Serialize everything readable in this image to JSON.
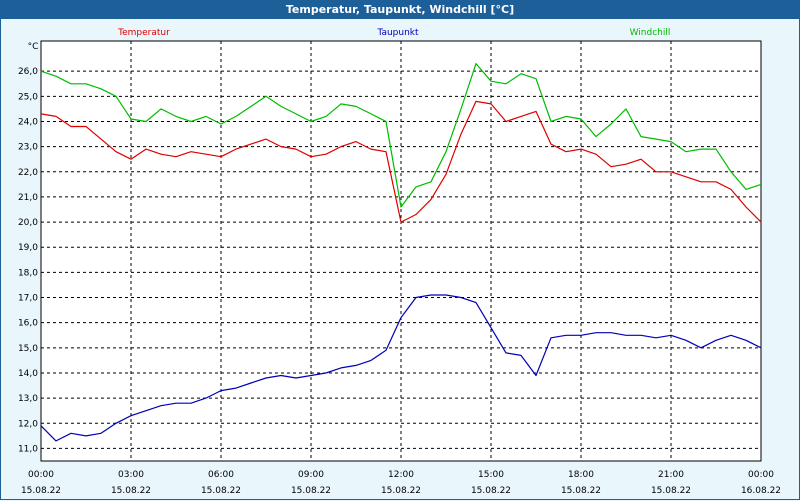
{
  "window": {
    "title": "Temperatur, Taupunkt, Windchill [°C]"
  },
  "colors": {
    "titlebar": "#1c5f99",
    "background": "#e9f6fb"
  },
  "chart_data": {
    "type": "line",
    "title": "Temperatur, Taupunkt, Windchill [°C]",
    "ylabel": "°C",
    "xlabel": "",
    "ylim": [
      10.5,
      27.2
    ],
    "xlim": [
      0,
      24
    ],
    "grid": true,
    "legend_position": "top",
    "y_ticks": [
      "11,0",
      "12,0",
      "13,0",
      "14,0",
      "15,0",
      "16,0",
      "17,0",
      "18,0",
      "19,0",
      "20,0",
      "21,0",
      "22,0",
      "23,0",
      "24,0",
      "25,0",
      "26,0"
    ],
    "x_ticks": [
      {
        "time": "00:00",
        "date": "15.08.22"
      },
      {
        "time": "03:00",
        "date": "15.08.22"
      },
      {
        "time": "06:00",
        "date": "15.08.22"
      },
      {
        "time": "09:00",
        "date": "15.08.22"
      },
      {
        "time": "12:00",
        "date": "15.08.22"
      },
      {
        "time": "15:00",
        "date": "15.08.22"
      },
      {
        "time": "18:00",
        "date": "15.08.22"
      },
      {
        "time": "21:00",
        "date": "15.08.22"
      },
      {
        "time": "00:00",
        "date": "16.08.22"
      }
    ],
    "x_hours": [
      0,
      0.5,
      1,
      1.5,
      2,
      2.5,
      3,
      3.5,
      4,
      4.5,
      5,
      5.5,
      6,
      6.5,
      7,
      7.5,
      8,
      8.5,
      9,
      9.5,
      10,
      10.5,
      11,
      11.5,
      12,
      12.5,
      13,
      13.5,
      14,
      14.5,
      15,
      15.5,
      16,
      16.5,
      17,
      17.5,
      18,
      18.5,
      19,
      19.5,
      20,
      20.5,
      21,
      21.5,
      22,
      22.5,
      23,
      23.5,
      24
    ],
    "series": [
      {
        "name": "Temperatur",
        "color": "#dd0000",
        "values": [
          24.3,
          24.2,
          23.8,
          23.8,
          23.3,
          22.8,
          22.5,
          22.9,
          22.7,
          22.6,
          22.8,
          22.7,
          22.6,
          22.9,
          23.1,
          23.3,
          23.0,
          22.9,
          22.6,
          22.7,
          23.0,
          23.2,
          22.9,
          22.8,
          20.0,
          20.3,
          20.9,
          21.9,
          23.5,
          24.8,
          24.7,
          24.0,
          24.2,
          24.4,
          23.1,
          22.8,
          22.9,
          22.7,
          22.2,
          22.3,
          22.5,
          22.0,
          22.0,
          21.8,
          21.6,
          21.6,
          21.3,
          20.6,
          20.0
        ]
      },
      {
        "name": "Taupunkt",
        "color": "#0000bb",
        "values": [
          11.9,
          11.3,
          11.6,
          11.5,
          11.6,
          12.0,
          12.3,
          12.5,
          12.7,
          12.8,
          12.8,
          13.0,
          13.3,
          13.4,
          13.6,
          13.8,
          13.9,
          13.8,
          13.9,
          14.0,
          14.2,
          14.3,
          14.5,
          14.9,
          16.2,
          17.0,
          17.1,
          17.1,
          17.0,
          16.8,
          15.8,
          14.8,
          14.7,
          13.9,
          15.4,
          15.5,
          15.5,
          15.6,
          15.6,
          15.5,
          15.5,
          15.4,
          15.5,
          15.3,
          15.0,
          15.3,
          15.5,
          15.3,
          15.0
        ]
      },
      {
        "name": "Windchill",
        "color": "#00bb00",
        "values": [
          26.0,
          25.8,
          25.5,
          25.5,
          25.3,
          25.0,
          24.1,
          24.0,
          24.5,
          24.2,
          24.0,
          24.2,
          23.9,
          24.2,
          24.6,
          25.0,
          24.6,
          24.3,
          24.0,
          24.2,
          24.7,
          24.6,
          24.3,
          24.0,
          20.6,
          21.4,
          21.6,
          22.8,
          24.5,
          26.3,
          25.6,
          25.5,
          25.9,
          25.7,
          24.0,
          24.2,
          24.1,
          23.4,
          23.9,
          24.5,
          23.4,
          23.3,
          23.2,
          22.8,
          22.9,
          22.9,
          22.0,
          21.3,
          21.5
        ]
      }
    ]
  }
}
